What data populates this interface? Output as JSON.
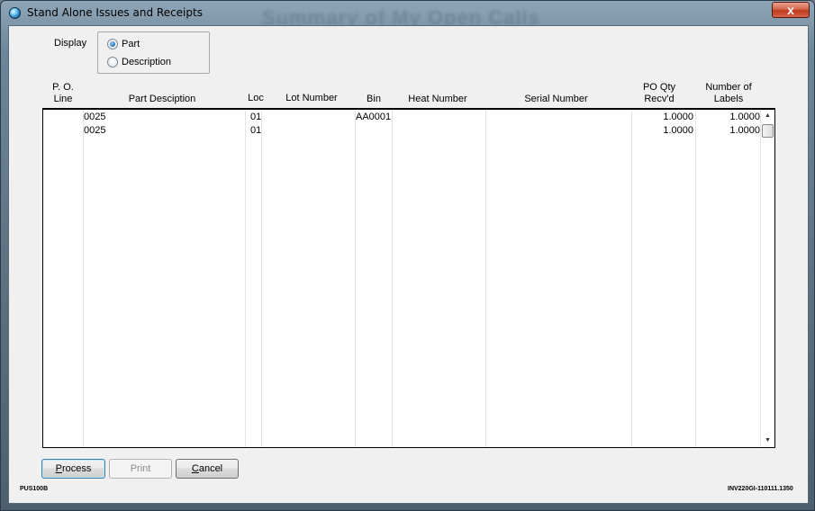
{
  "window": {
    "title": "Stand Alone Issues and Receipts",
    "background_title": "Summary of My Open Calls",
    "close_label": "x"
  },
  "display": {
    "label": "Display",
    "options": [
      {
        "label": "Part",
        "checked": true
      },
      {
        "label": "Description",
        "checked": false
      }
    ]
  },
  "columns": {
    "po_line": [
      "P. O.",
      "Line"
    ],
    "part_description": "Part Desciption",
    "loc": "Loc",
    "lot_number": "Lot Number",
    "bin": "Bin",
    "heat_number": "Heat Number",
    "serial_number": "Serial Number",
    "po_qty": [
      "PO Qty",
      "Recv'd"
    ],
    "labels": [
      "Number of",
      "Labels"
    ]
  },
  "rows": [
    {
      "po_line": "",
      "part": "0025",
      "loc": "01",
      "lot": "",
      "bin": "AA0001",
      "heat": "",
      "serial": "",
      "po_qty": "1.0000",
      "labels": "1.0000"
    },
    {
      "po_line": "",
      "part": "0025",
      "loc": "01",
      "lot": "",
      "bin": "",
      "heat": "",
      "serial": "",
      "po_qty": "1.0000",
      "labels": "1.0000"
    }
  ],
  "buttons": {
    "process": {
      "prefix": "",
      "mnemonic": "P",
      "rest": "rocess"
    },
    "print": {
      "prefix": "",
      "mnemonic": "",
      "rest": "Print"
    },
    "cancel": {
      "prefix": "",
      "mnemonic": "C",
      "rest": "ancel"
    }
  },
  "footer": {
    "left": "PUS100B",
    "right": "INV220GI-110111.1350"
  },
  "icons": {
    "app": "globe-icon",
    "scroll_up": "arrow-up-icon",
    "scroll_down": "arrow-down-icon"
  }
}
